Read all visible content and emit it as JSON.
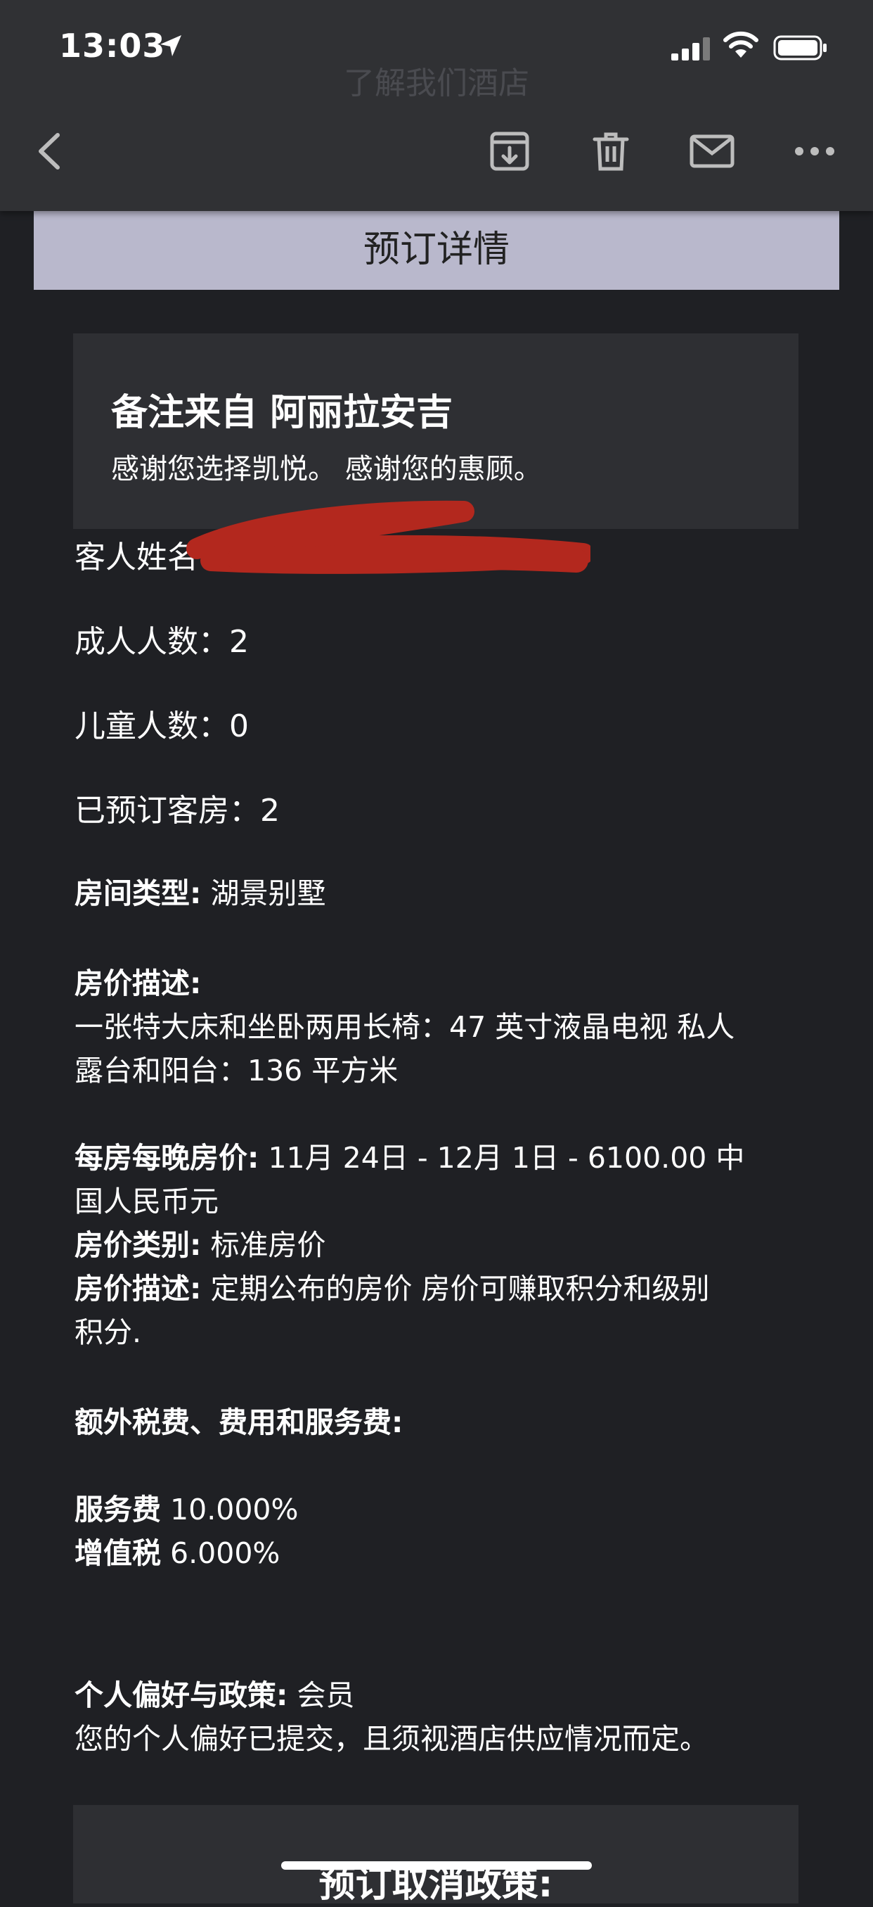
{
  "status": {
    "time": "13:03"
  },
  "nav": {
    "ghost_title": "了解我们酒店"
  },
  "header": {
    "title": "预订详情"
  },
  "note": {
    "title": "备注来自 阿丽拉安吉",
    "text": "感谢您选择凯悦。 感谢您的惠顾。"
  },
  "details": {
    "guest_name_label": "客人姓名",
    "adults": "成人人数：2",
    "children": "儿童人数：0",
    "rooms": "已预订客房：2",
    "room_type_label": "房间类型:",
    "room_type_value": " 湖景别墅",
    "rate_desc_label": "房价描述:",
    "rate_desc_line1": "一张特大床和坐卧两用长椅：47 英寸液晶电视 私人",
    "rate_desc_line2": "露台和阳台：136 平方米",
    "nightly_label": "每房每晚房价:",
    "nightly_value": " 11月 24日 - 12月 1日 - 6100.00 中",
    "nightly_value2": "国人民币元",
    "rate_category_label": "房价类别:",
    "rate_category_value": " 标准房价",
    "rate_desc2_label": "房价描述:",
    "rate_desc2_value": " 定期公布的房价 房价可赚取积分和级别",
    "rate_desc2_value2": "积分.",
    "taxes_label": "额外税费、费用和服务费:",
    "service_label": "服务费",
    "service_value": " 10.000%",
    "vat_label": "增值税",
    "vat_value": " 6.000%",
    "prefs_label": "个人偏好与政策:",
    "prefs_value": "  会员",
    "prefs_text": "您的个人偏好已提交，且须视酒店供应情况而定。"
  },
  "cancel": {
    "title": "预订取消政策:"
  }
}
